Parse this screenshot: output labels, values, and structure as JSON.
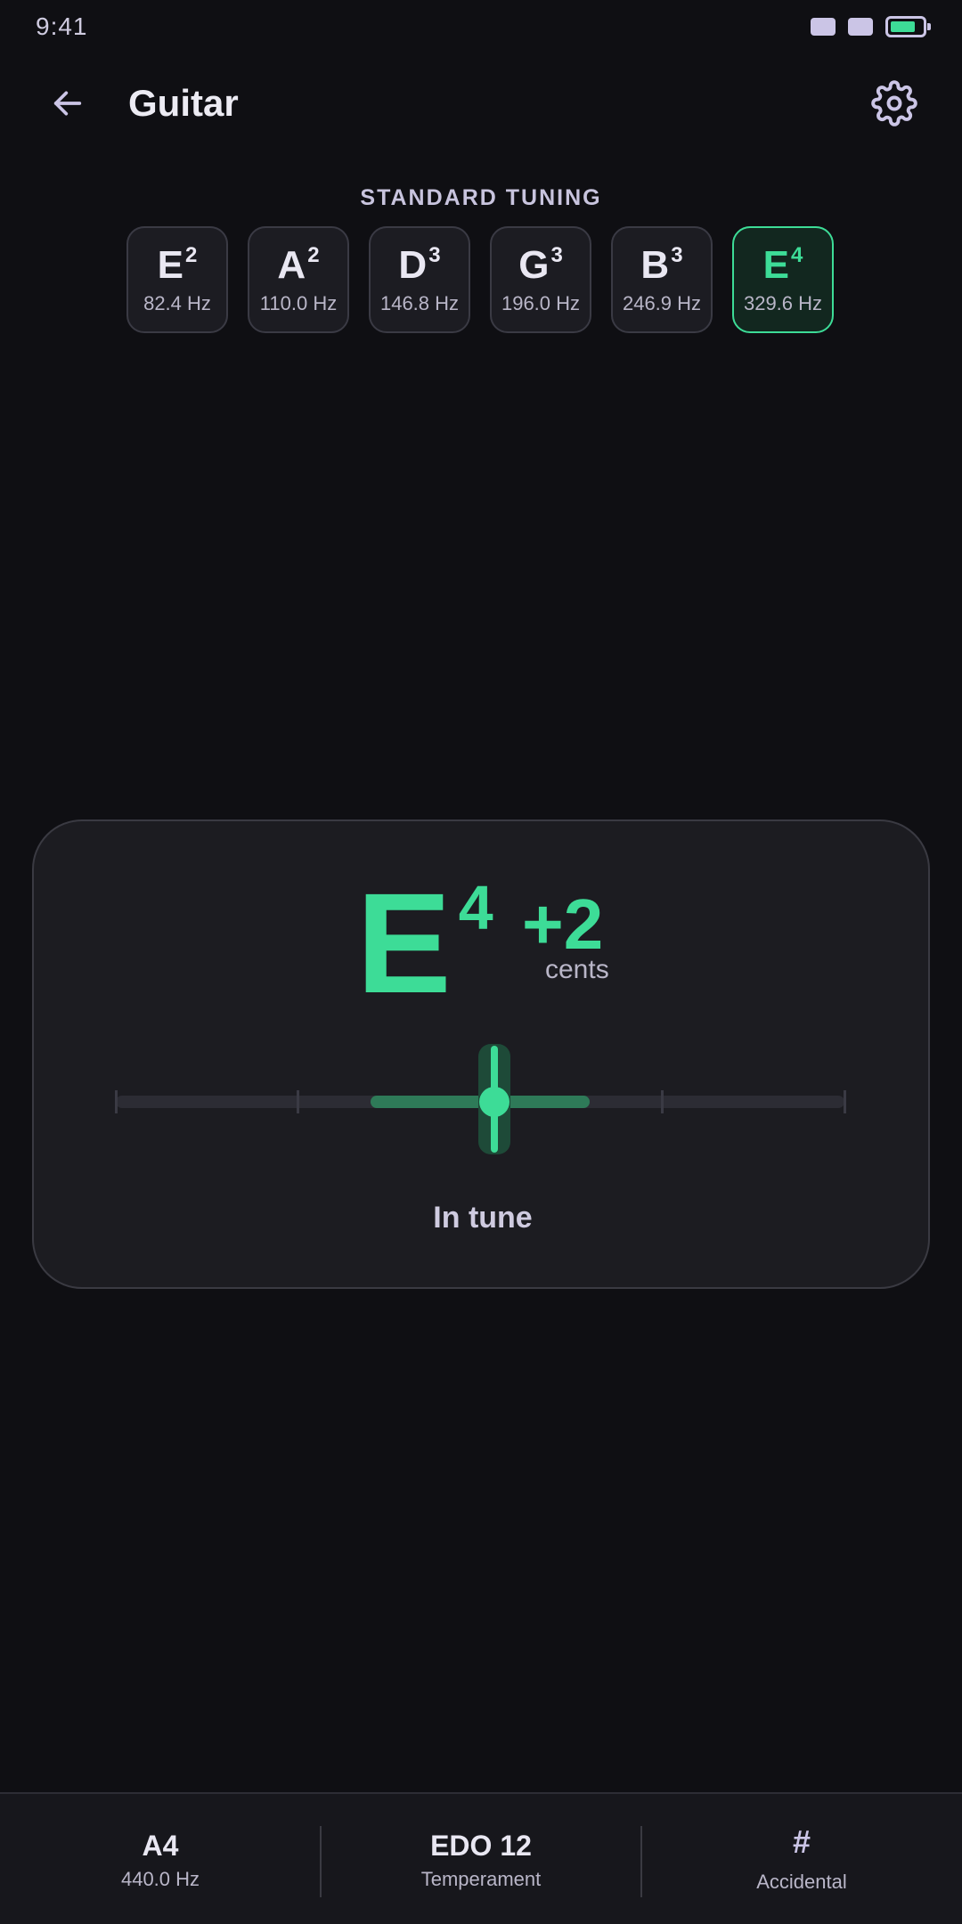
{
  "status_bar": {
    "time": "9:41",
    "battery_level": 0.8
  },
  "app_bar": {
    "title": "Guitar",
    "back_icon": "arrow-left-icon",
    "settings_icon": "gear-icon"
  },
  "tuning": {
    "label": "STANDARD TUNING",
    "strings": [
      {
        "note": "E",
        "octave": "2",
        "freq": "82.4 Hz",
        "active": false
      },
      {
        "note": "A",
        "octave": "2",
        "freq": "110.0 Hz",
        "active": false
      },
      {
        "note": "D",
        "octave": "3",
        "freq": "146.8 Hz",
        "active": false
      },
      {
        "note": "G",
        "octave": "3",
        "freq": "196.0 Hz",
        "active": false
      },
      {
        "note": "B",
        "octave": "3",
        "freq": "246.9 Hz",
        "active": false
      },
      {
        "note": "E",
        "octave": "4",
        "freq": "329.6 Hz",
        "active": true
      }
    ]
  },
  "tuner": {
    "note": "E",
    "octave": "4",
    "cents": "+2",
    "cents_unit": "cents",
    "cents_numeric": 2,
    "meter_range": [
      -50,
      50
    ],
    "in_tune_zone": [
      -15,
      15
    ],
    "status": "In tune"
  },
  "bottom_bar": {
    "reference": {
      "main": "A4",
      "sub": "440.0 Hz"
    },
    "temperament": {
      "main": "EDO 12",
      "sub": "Temperament"
    },
    "accidental": {
      "main": "#",
      "sub": "Accidental",
      "icon": "sharp-icon"
    }
  },
  "colors": {
    "accent": "#3ddc97",
    "background": "#0f0f13",
    "card": "#1c1c21"
  }
}
